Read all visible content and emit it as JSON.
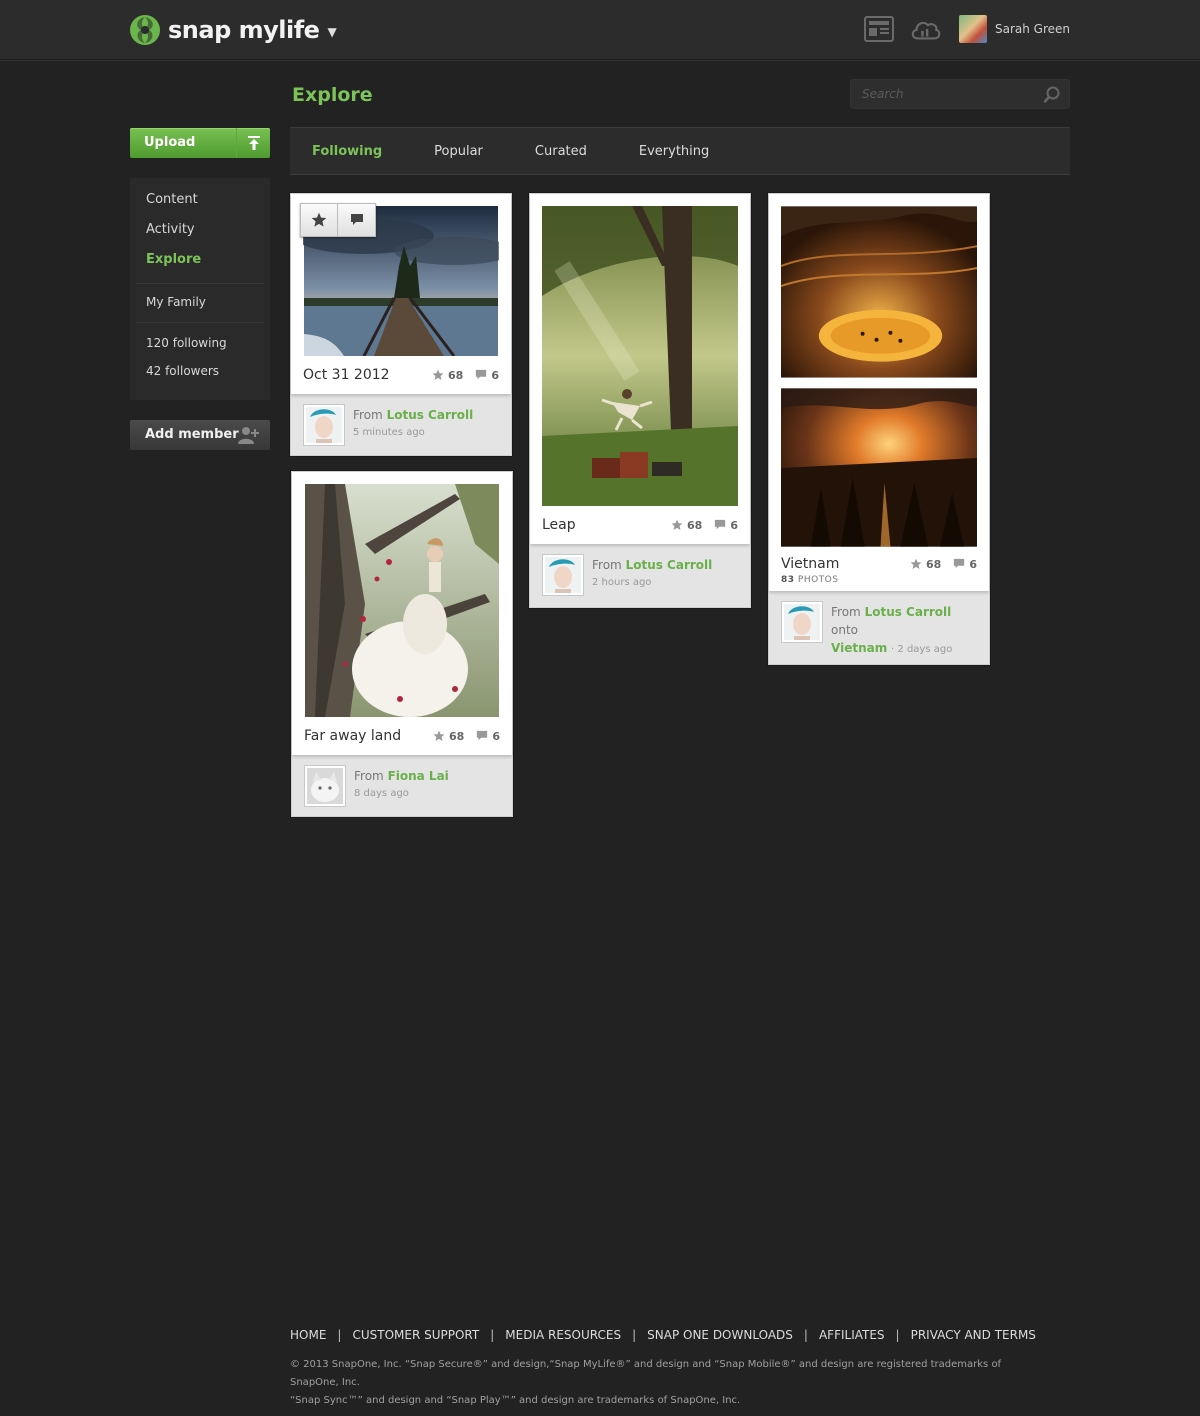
{
  "app": {
    "name": "snap mylife"
  },
  "header": {
    "user_name": "Sarah Green"
  },
  "sidebar": {
    "upload_label": "Upload",
    "items": [
      {
        "label": "Content"
      },
      {
        "label": "Activity"
      },
      {
        "label": "Explore",
        "active": true
      }
    ],
    "family_label": "My Family",
    "following_label": "120 following",
    "followers_label": "42 followers",
    "add_member_label": "Add member"
  },
  "main": {
    "title": "Explore",
    "search_placeholder": "Search",
    "tabs": [
      {
        "label": "Following",
        "active": true
      },
      {
        "label": "Popular"
      },
      {
        "label": "Curated"
      },
      {
        "label": "Everything"
      }
    ]
  },
  "cards": [
    {
      "title": "Oct 31 2012",
      "stars": "68",
      "comments": "6",
      "from_prefix": "From",
      "author": "Lotus Carroll",
      "time": "5 minutes ago"
    },
    {
      "title": "Far away land",
      "stars": "68",
      "comments": "6",
      "from_prefix": "From",
      "author": "Fiona Lai",
      "time": "8 days ago"
    },
    {
      "title": "Leap",
      "stars": "68",
      "comments": "6",
      "from_prefix": "From",
      "author": "Lotus Carroll",
      "time": "2 hours ago"
    },
    {
      "title": "Vietnam",
      "stars": "68",
      "comments": "6",
      "photos_count": "83",
      "photos_label": "PHOTOS",
      "from_prefix": "From",
      "author": "Lotus Carroll",
      "onto": "onto",
      "album": "Vietnam",
      "time": "· 2 days ago"
    }
  ],
  "footer": {
    "links": [
      "HOME",
      "CUSTOMER SUPPORT",
      "MEDIA RESOURCES",
      "SNAP ONE DOWNLOADS",
      "AFFILIATES",
      "PRIVACY AND TERMS"
    ],
    "separator": "|",
    "legal_line1": "© 2013 SnapOne, Inc.  “Snap Secure®” and design,“Snap MyLife®” and design and “Snap Mobile®” and design are registered trademarks of SnapOne, Inc.",
    "legal_line2": "“Snap Sync™” and design and “Snap Play™” and design are trademarks of SnapOne, Inc."
  },
  "colors": {
    "accent": "#7cc35a",
    "background": "#222222",
    "topbar": "#2c2c2c"
  }
}
